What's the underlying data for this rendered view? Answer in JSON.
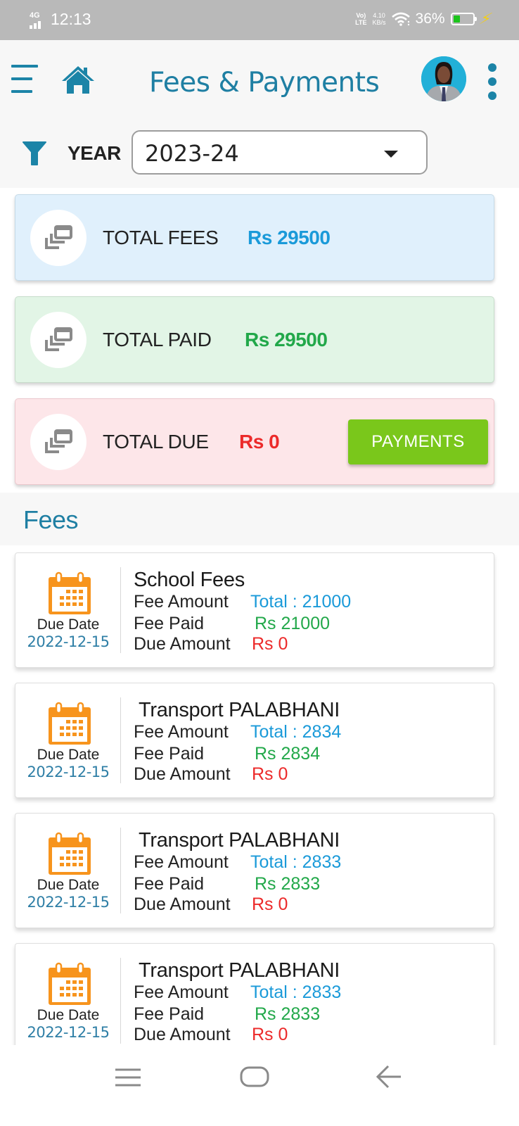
{
  "status_bar": {
    "network": "4G",
    "time": "12:13",
    "volte_top": "Vo)",
    "volte_bottom": "LTE",
    "speed_value": "4.10",
    "speed_unit": "KB/s",
    "battery_text": "36%",
    "battery_level_percent": 36
  },
  "header": {
    "title": "Fees & Payments",
    "icons": {
      "menu": "menu-icon",
      "home": "home-icon",
      "avatar": "profile-avatar",
      "more": "more-vertical-icon"
    }
  },
  "filter": {
    "label": "YEAR",
    "selected_year": "2023-24",
    "icon": "filter-icon"
  },
  "summary": {
    "total_fees": {
      "label": "TOTAL FEES",
      "value": "Rs 29500",
      "color": "#1a9ad9"
    },
    "total_paid": {
      "label": "TOTAL PAID",
      "value": "Rs 29500",
      "color": "#22a84a"
    },
    "total_due": {
      "label": "TOTAL DUE",
      "value": "Rs 0",
      "color": "#ec2a2a"
    },
    "payments_button": "PAYMENTS"
  },
  "fees_section": {
    "heading": "Fees",
    "row_labels": {
      "fee_amount": "Fee Amount",
      "fee_paid": "Fee Paid",
      "due_amount": "Due Amount",
      "due_date": "Due Date"
    },
    "items": [
      {
        "title": "School Fees",
        "due_date": "2022-12-15",
        "total": "Total : 21000",
        "paid": "Rs 21000",
        "due": "Rs 0"
      },
      {
        "title": "Transport PALABHANI",
        "due_date": "2022-12-15",
        "total": "Total : 2834",
        "paid": "Rs 2834",
        "due": "Rs 0"
      },
      {
        "title": "Transport PALABHANI",
        "due_date": "2022-12-15",
        "total": "Total : 2833",
        "paid": "Rs 2833",
        "due": "Rs 0"
      },
      {
        "title": "Transport PALABHANI",
        "due_date": "2022-12-15",
        "total": "Total : 2833",
        "paid": "Rs 2833",
        "due": "Rs 0"
      }
    ]
  },
  "colors": {
    "brand": "#1f7fa3",
    "accent_green": "#7ac71b",
    "calendar_orange": "#f7941d"
  }
}
